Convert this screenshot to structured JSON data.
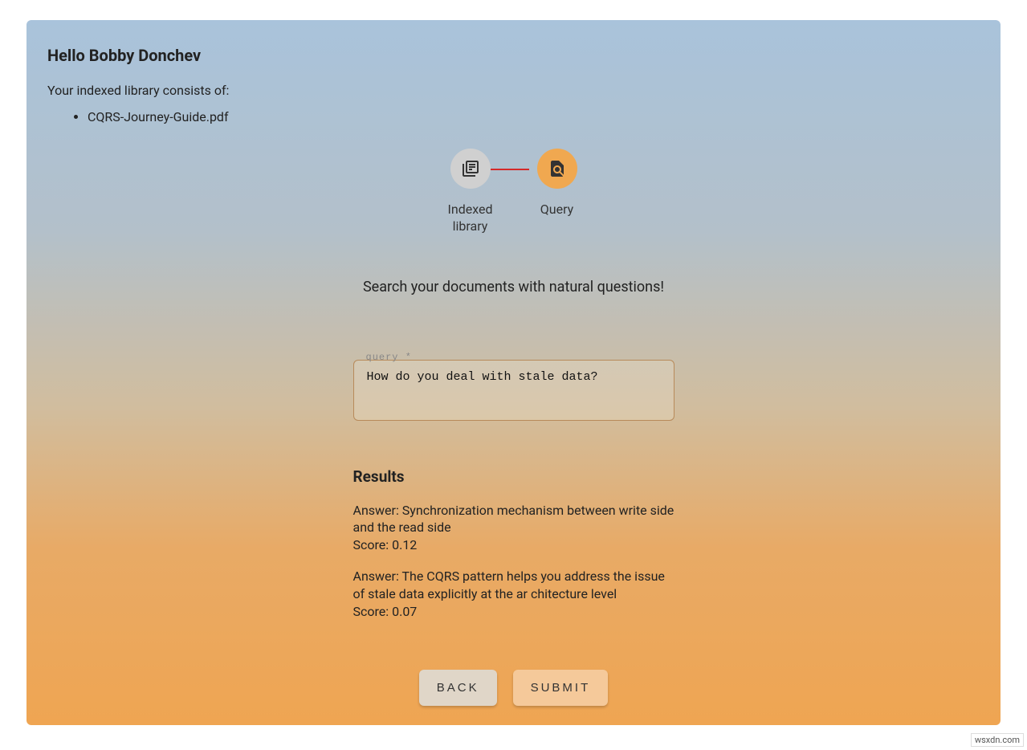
{
  "header": {
    "greeting": "Hello Bobby Donchev",
    "intro": "Your indexed library consists of:",
    "files": [
      "CQRS-Journey-Guide.pdf"
    ]
  },
  "stepper": {
    "step1_label": "Indexed library",
    "step2_label": "Query"
  },
  "search": {
    "prompt": "Search your documents with natural questions!",
    "query_label": "query *",
    "query_value": "How do you deal with stale data?"
  },
  "results": {
    "title": "Results",
    "items": [
      {
        "answer": "Answer: Synchronization mechanism between write side and the read side",
        "score": "Score: 0.12"
      },
      {
        "answer": "Answer: The CQRS pattern helps you address the issue of stale data explicitly at the ar chitecture level",
        "score": "Score: 0.07"
      }
    ]
  },
  "buttons": {
    "back": "BACK",
    "submit": "SUBMIT"
  },
  "watermark": "wsxdn.com"
}
